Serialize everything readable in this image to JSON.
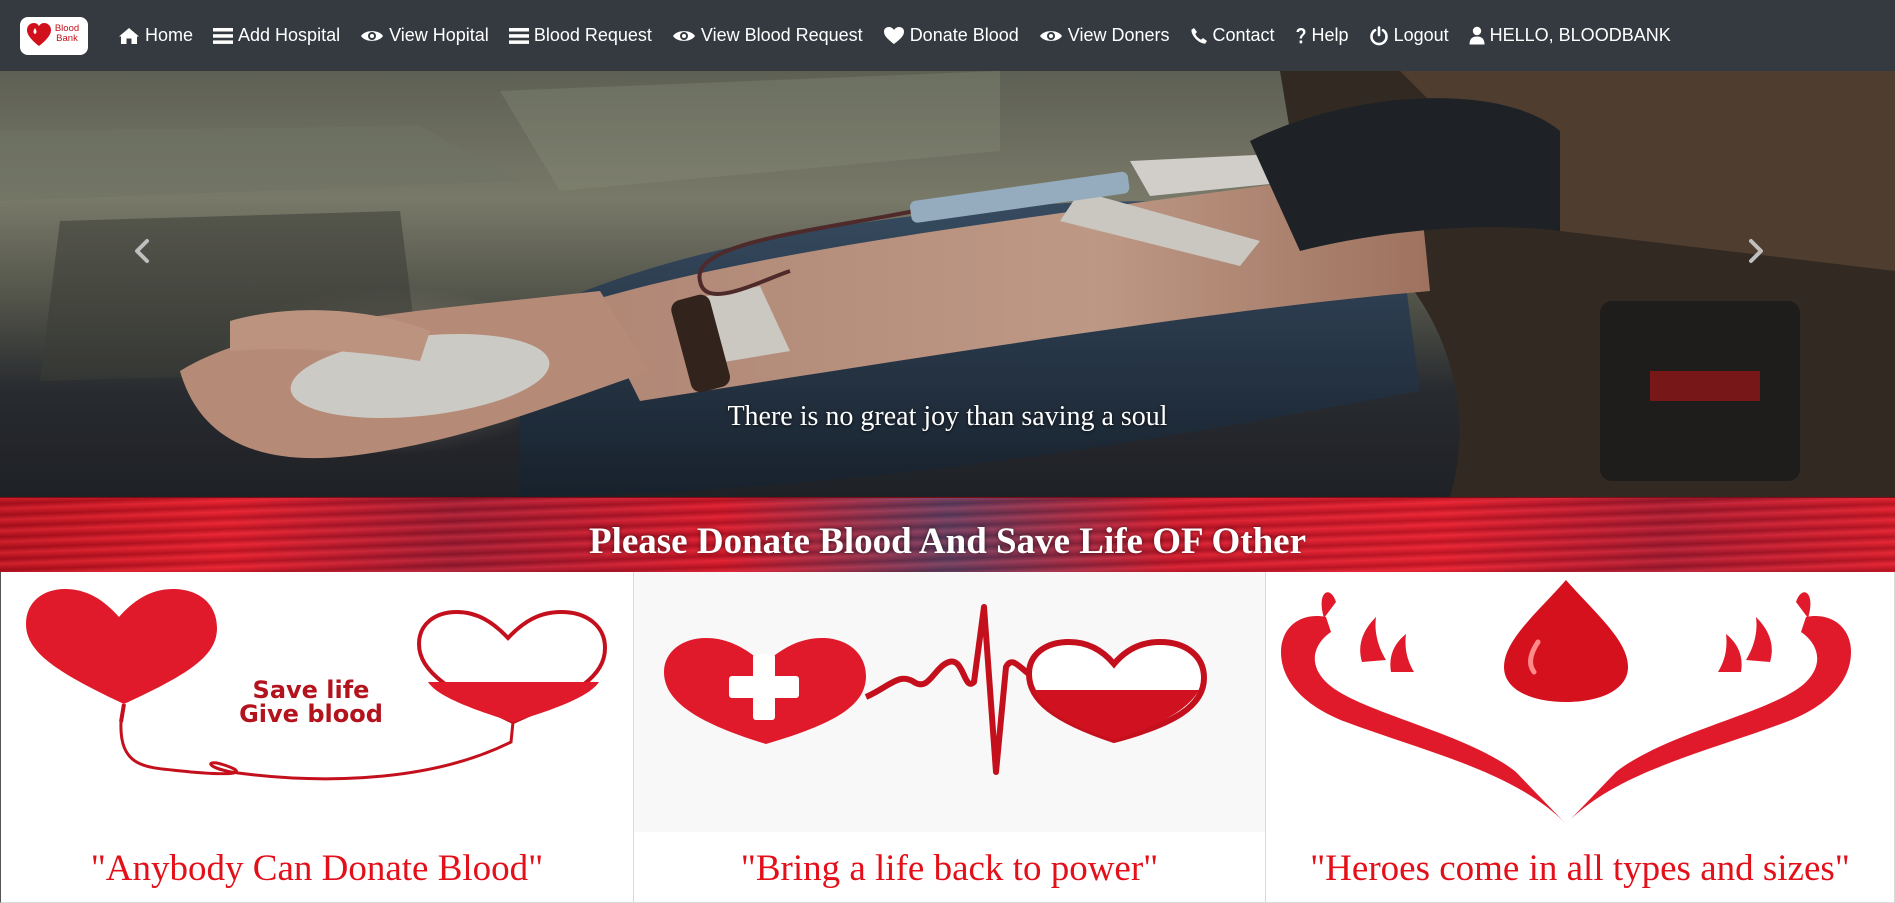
{
  "brand": {
    "logo_text": "Blood Bank",
    "accent": "#d0101a"
  },
  "nav": {
    "background": "#343a40",
    "items": [
      {
        "label": "Home",
        "icon": "home-icon"
      },
      {
        "label": "Add Hospital",
        "icon": "list-icon"
      },
      {
        "label": "View Hopital",
        "icon": "eye-icon"
      },
      {
        "label": "Blood Request",
        "icon": "list-icon"
      },
      {
        "label": "View Blood Request",
        "icon": "eye-icon"
      },
      {
        "label": "Donate Blood",
        "icon": "heart-icon"
      },
      {
        "label": "View Doners",
        "icon": "eye-icon"
      },
      {
        "label": "Contact",
        "icon": "phone-icon"
      },
      {
        "label": "Help",
        "icon": "question-icon"
      },
      {
        "label": "Logout",
        "icon": "power-icon"
      },
      {
        "label": "HELLO, BLOODBANK",
        "icon": "user-icon"
      }
    ]
  },
  "carousel": {
    "caption": "There is no great joy than saving a soul",
    "prev_icon": "chevron-left-icon",
    "next_icon": "chevron-right-icon"
  },
  "banner": {
    "title": "Please Donate Blood And Save Life OF Other"
  },
  "cards": [
    {
      "image_text": "Save life Give blood",
      "image_text_line1": "Save life",
      "image_text_line2": "Give blood",
      "quote": "\"Anybody Can Donate Blood\""
    },
    {
      "quote": "\"Bring a life back to power\""
    },
    {
      "quote": "\"Heroes come in all types and sizes\""
    }
  ],
  "colors": {
    "quote_red": "#e3101a",
    "heart_red": "#e01a2a"
  }
}
